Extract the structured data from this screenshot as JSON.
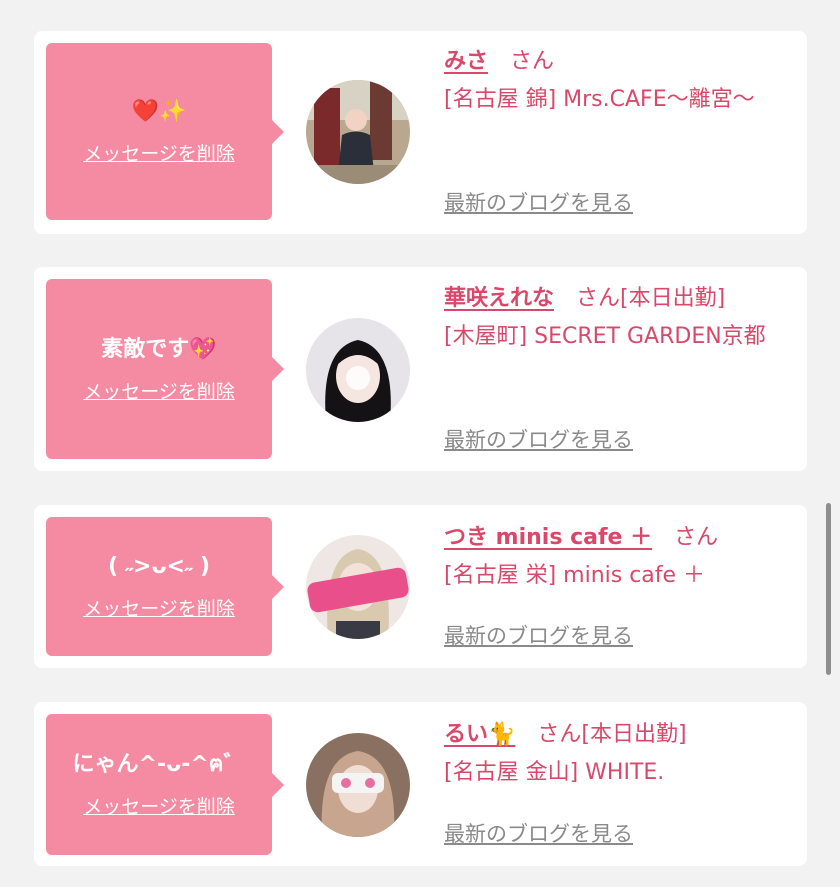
{
  "entries": [
    {
      "message": "❤️✨",
      "delete_label": "メッセージを削除",
      "name": "みさ",
      "honorific": "さん",
      "status": "",
      "shop": "[名古屋 錦] Mrs.CAFE〜離宮〜",
      "blog_label": "最新のブログを見る"
    },
    {
      "message": "素敵です💖",
      "delete_label": "メッセージを削除",
      "name": "華咲えれな",
      "honorific": "さん",
      "status": "[本日出勤]",
      "shop": "[木屋町] SECRET GARDEN京都",
      "blog_label": "最新のブログを見る"
    },
    {
      "message": "( ˶>ᴗ<˶ )",
      "delete_label": "メッセージを削除",
      "name": "つき minis cafe ＋",
      "honorific": "さん",
      "status": "",
      "shop": "[名古屋 栄] minis cafe ＋",
      "blog_label": "最新のブログを見る"
    },
    {
      "message": "にゃん^-ᴗ-^ฅ゛",
      "delete_label": "メッセージを削除",
      "name": "るい🐈",
      "honorific": "さん",
      "status": "[本日出勤]",
      "shop": "[名古屋 金山] WHITE.",
      "blog_label": "最新のブログを見る"
    }
  ],
  "colors": {
    "page_bg": "#f2f2f2",
    "bubble": "#f58ba2",
    "accent_text": "#d9486a",
    "link_gray": "#8a8a8a"
  }
}
